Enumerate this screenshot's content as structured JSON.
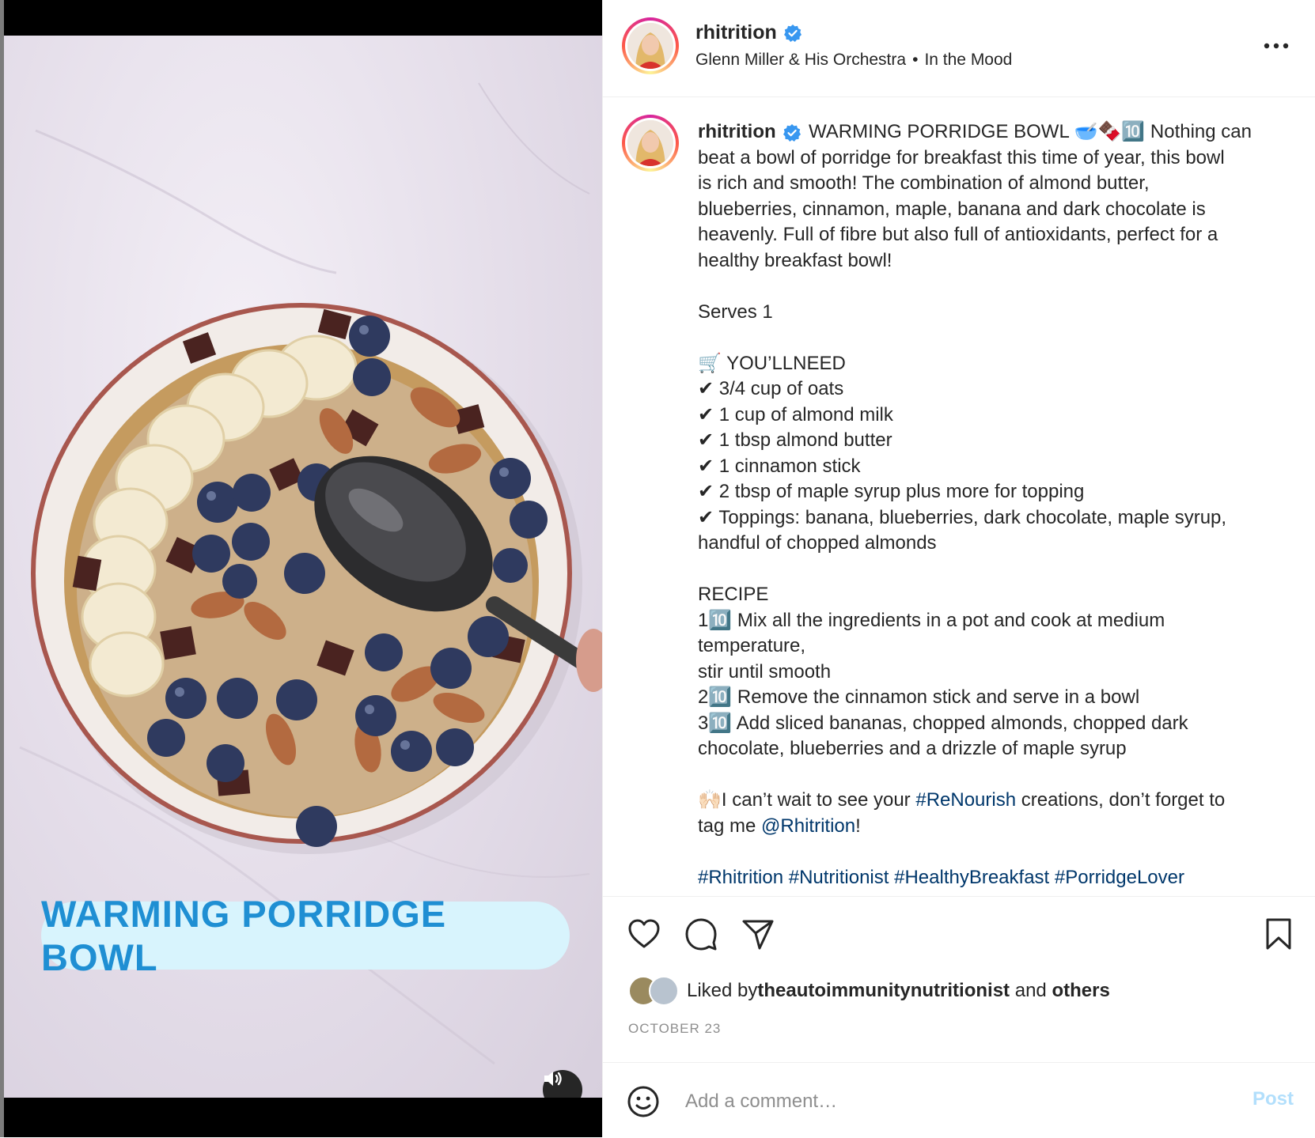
{
  "post": {
    "username": "rhitrition",
    "audio_artist": "Glenn Miller & His Orchestra",
    "audio_separator": "•",
    "audio_title": "In the Mood",
    "overlay_title": "WARMING PORRIDGE BOWL"
  },
  "caption": {
    "username": "rhitrition",
    "lines": [
      "WARMING PORRIDGE BOWL 🥣🍫🔟 Nothing can",
      "beat a bowl of porridge for breakfast this time of year, this bowl",
      "is rich and smooth! The combination of almond butter,",
      "blueberries, cinnamon, maple, banana and dark chocolate is",
      "heavenly. Full of fibre but also full of antioxidants, perfect for a",
      "healthy breakfast bowl!",
      "",
      "Serves 1",
      "",
      "🛒 YOU’LLNEED",
      "✔ 3/4 cup of oats",
      "✔ 1 cup of almond milk",
      "✔ 1 tbsp almond butter",
      "✔ 1 cinnamon stick",
      "✔ 2 tbsp of maple syrup plus more for topping",
      "✔ Toppings: banana, blueberries, dark chocolate, maple syrup,",
      "handful of chopped almonds",
      "",
      "RECIPE",
      "1🔟 Mix all the ingredients in a pot and cook at medium",
      "temperature,",
      "stir until smooth",
      "2🔟 Remove the cinnamon stick and serve in a bowl",
      "3🔟 Add sliced bananas, chopped almonds, chopped dark",
      "chocolate, blueberries and a drizzle of maple syrup",
      ""
    ],
    "cta_prefix": "🙌🏻I can’t wait to see your ",
    "cta_hashtag": "#ReNourish",
    "cta_middle": " creations, don’t forget to",
    "cta_line2_prefix": "tag me ",
    "cta_mention": "@Rhitrition",
    "cta_suffix": "!",
    "hashtags": [
      "#Rhitrition",
      "#Nutritionist",
      "#HealthyBreakfast",
      "#PorridgeLover"
    ]
  },
  "actions": {
    "liked_prefix": "Liked by ",
    "liked_user": "theautoimmunitynutritionist",
    "liked_and": " and ",
    "liked_others": "others",
    "date": "OCTOBER 23"
  },
  "comment": {
    "placeholder": "Add a comment…",
    "post_label": "Post"
  },
  "colors": {
    "link": "#00376b",
    "verified": "#3897f0",
    "overlay_text": "#1f8fd3",
    "overlay_bg": "#d8f4fd",
    "post_disabled": "#b2dffc"
  },
  "icons": [
    "verified-badge-icon",
    "more-options-icon",
    "heart-icon",
    "comment-icon",
    "share-icon",
    "bookmark-icon",
    "emoji-icon",
    "volume-icon"
  ]
}
